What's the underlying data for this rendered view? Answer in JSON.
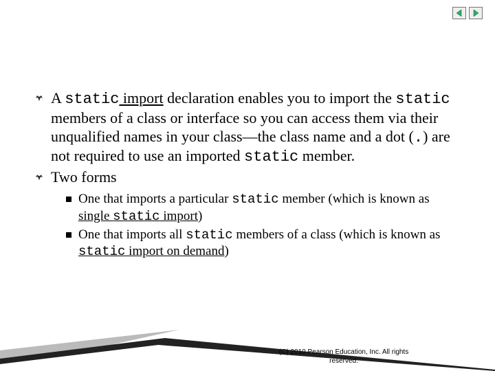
{
  "nav": {
    "prev_label": "Previous",
    "next_label": "Next"
  },
  "bullet1": {
    "p1": "A ",
    "code1": "static",
    "p2": " import",
    "p3": " declaration enables you to import the ",
    "code2": "static",
    "p4": " members of a class or interface so you can access them via their unqualified names in your class—the class name and a dot (",
    "code3": ".",
    "p5": ") are not required to use an imported ",
    "code4": "static",
    "p6": " member."
  },
  "bullet2": {
    "text": "Two forms"
  },
  "sub1": {
    "p1": "One that imports a particular ",
    "code1": "static",
    "p2": " member (which is known as ",
    "u1a": "single ",
    "u1b_code": "static",
    "u1c": " import",
    "p3": ")"
  },
  "sub2": {
    "p1": "One that imports all ",
    "code1": "static",
    "p2": " members of a class (which is known as ",
    "u1a_code": "static",
    "u1b": " import on demand",
    "p3": ")"
  },
  "copyright": "(C) 2010 Pearson Education, Inc. All rights reserved."
}
